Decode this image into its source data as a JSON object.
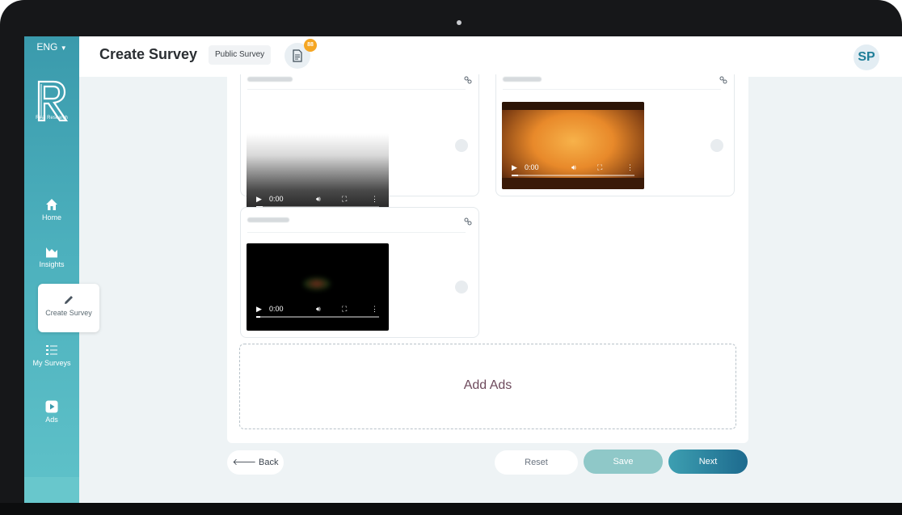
{
  "header": {
    "title": "Create Survey",
    "survey_type": "Public Survey",
    "notification_count": "88",
    "avatar_initials": "SP"
  },
  "sidebar": {
    "language": "ENG",
    "logo_caption": "Real Research",
    "items": [
      {
        "label": "Home",
        "icon": "home-icon"
      },
      {
        "label": "Insights",
        "icon": "chart-icon"
      },
      {
        "label": "Create Survey",
        "icon": "pencil-icon"
      },
      {
        "label": "My Surveys",
        "icon": "list-icon"
      },
      {
        "label": "Ads",
        "icon": "play-icon"
      }
    ]
  },
  "ads": [
    {
      "time": "0:00",
      "progress": 0.05
    },
    {
      "time": "0:00",
      "progress": 0.05
    },
    {
      "time": "0:00",
      "progress": 0.03
    }
  ],
  "add_ads_label": "Add Ads",
  "buttons": {
    "back": "Back",
    "reset": "Reset",
    "save": "Save",
    "next": "Next"
  },
  "colors": {
    "sidebar": "#3a9aac",
    "next_button": "#1d6a8e",
    "save_button": "#8fc8c8",
    "badge": "#f5a623"
  }
}
